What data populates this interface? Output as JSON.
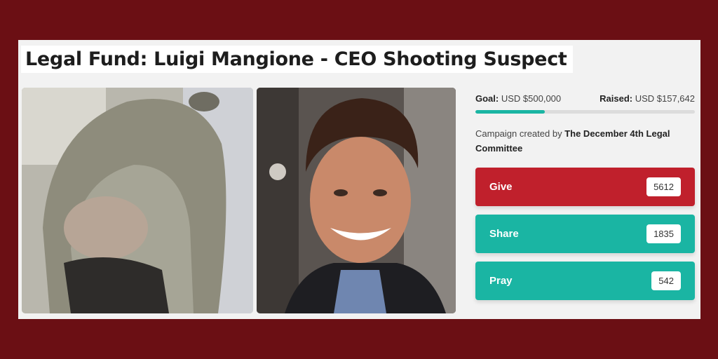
{
  "title": "Legal Fund: Luigi Mangione - CEO Shooting Suspect",
  "colors": {
    "background": "#6b0f14",
    "give": "#c0202c",
    "accent": "#1ab5a3"
  },
  "stats": {
    "goal_label": "Goal:",
    "goal_value": "USD $500,000",
    "raised_label": "Raised:",
    "raised_value": "USD $157,642",
    "progress_fraction": 0.315
  },
  "creator": {
    "prefix": "Campaign created by",
    "name": "The December 4th Legal Committee"
  },
  "actions": [
    {
      "label": "Give",
      "count": "5612"
    },
    {
      "label": "Share",
      "count": "1835"
    },
    {
      "label": "Pray",
      "count": "542"
    }
  ],
  "photos": [
    {
      "icon": "hooded-person-photo"
    },
    {
      "icon": "smiling-person-photo"
    }
  ]
}
